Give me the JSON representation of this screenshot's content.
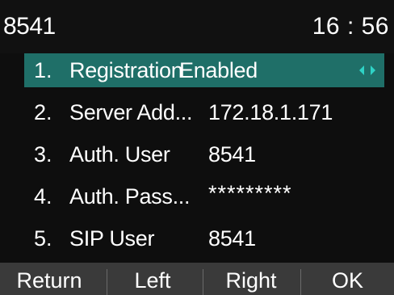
{
  "status_bar": {
    "account": "8541",
    "time": "16 : 56"
  },
  "menu": {
    "items": [
      {
        "index": "1.",
        "label": "Registration",
        "value": "Enabled",
        "selected": true,
        "has_arrows": true
      },
      {
        "index": "2.",
        "label": "Server Add...",
        "value": "172.18.1.171"
      },
      {
        "index": "3.",
        "label": "Auth. User",
        "value": "8541"
      },
      {
        "index": "4.",
        "label": "Auth. Pass...",
        "value": "*********"
      },
      {
        "index": "5.",
        "label": "SIP User",
        "value": "8541"
      }
    ],
    "selection_color": "#1f6f68",
    "arrow_color": "#2fd3c6"
  },
  "softkeys": {
    "return": "Return",
    "left": "Left",
    "right": "Right",
    "ok": "OK"
  },
  "colors": {
    "background": "#0e0e0e",
    "softkey_bar": "#3a3a3a",
    "text": "#ffffff"
  }
}
